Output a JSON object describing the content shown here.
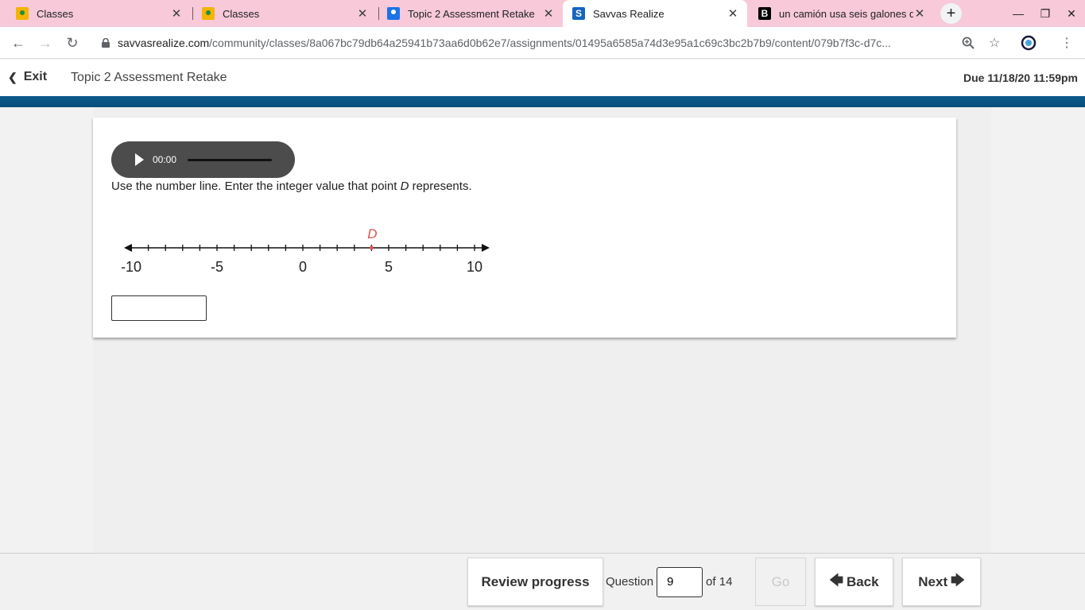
{
  "browser": {
    "tabs": [
      {
        "title": "Classes",
        "icon": "classroom-icon"
      },
      {
        "title": "Classes",
        "icon": "classroom-icon"
      },
      {
        "title": "Topic 2 Assessment Retake",
        "icon": "assignment-icon"
      },
      {
        "title": "Savvas Realize",
        "icon": "savvas-icon",
        "active": true
      },
      {
        "title": "un camión usa seis galones d",
        "icon": "brainly-icon"
      }
    ],
    "url_host": "savvasrealize.com",
    "url_path": "/community/classes/8a067bc79db64a25941b73aa6d0b62e7/assignments/01495a6585a74d3e95a1c69c3bc2b7b9/content/079b7f3c-d7c..."
  },
  "header": {
    "exit_label": "Exit",
    "title": "Topic 2 Assessment Retake",
    "due": "Due 11/18/20 11:59pm"
  },
  "question": {
    "audio_time": "00:00",
    "prompt_before": "Use the number line. Enter the integer value that point ",
    "prompt_point": "D",
    "prompt_after": " represents.",
    "answer_value": ""
  },
  "chart_data": {
    "type": "number-line",
    "min": -10,
    "max": 10,
    "tick_step": 1,
    "tick_labels": [
      "-10",
      "-5",
      "0",
      "5",
      "10"
    ],
    "point": {
      "label": "D",
      "value": 4,
      "color": "#d9534f"
    }
  },
  "footer": {
    "review_label": "Review progress",
    "question_label": "Question",
    "current_question": "9",
    "total_label": "of 14",
    "go_label": "Go",
    "back_label": "Back",
    "next_label": "Next"
  },
  "colors": {
    "tabbar": "#f7c9d9",
    "band": "#0e5a8c"
  }
}
